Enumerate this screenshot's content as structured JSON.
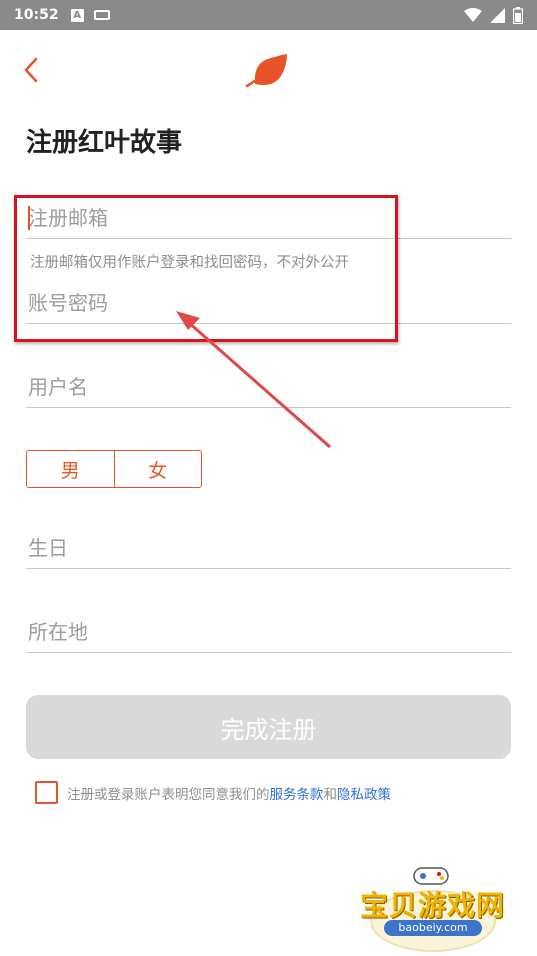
{
  "status_bar": {
    "time": "10:52",
    "a_icon": "A",
    "icons": [
      "notification-a-icon",
      "keyboard-icon",
      "wifi-icon",
      "signal-icon",
      "battery-icon"
    ]
  },
  "nav": {
    "back_icon": "chevron-left-icon",
    "logo_icon": "red-leaf-icon"
  },
  "title": "注册红叶故事",
  "form": {
    "email_placeholder": "注册邮箱",
    "email_hint": "注册邮箱仅用作账户登录和找回密码，不对外公开",
    "password_placeholder": "账号密码",
    "username_placeholder": "用户名",
    "gender": {
      "male": "男",
      "female": "女"
    },
    "birthday_placeholder": "生日",
    "location_placeholder": "所在地",
    "submit_label": "完成注册"
  },
  "agreement": {
    "text_prefix": "注册或登录账户表明您同意我们的",
    "terms_link": "服务条款",
    "and": "和",
    "privacy_link": "隐私政策"
  },
  "watermark": {
    "title": "宝贝游戏网",
    "url": "baobeiy.com"
  },
  "colors": {
    "accent": "#e8542a",
    "link": "#2f6fd3",
    "annotation": "#d8121f",
    "button_disabled": "#d9d9d9",
    "status_bar": "#8a8a8a"
  }
}
